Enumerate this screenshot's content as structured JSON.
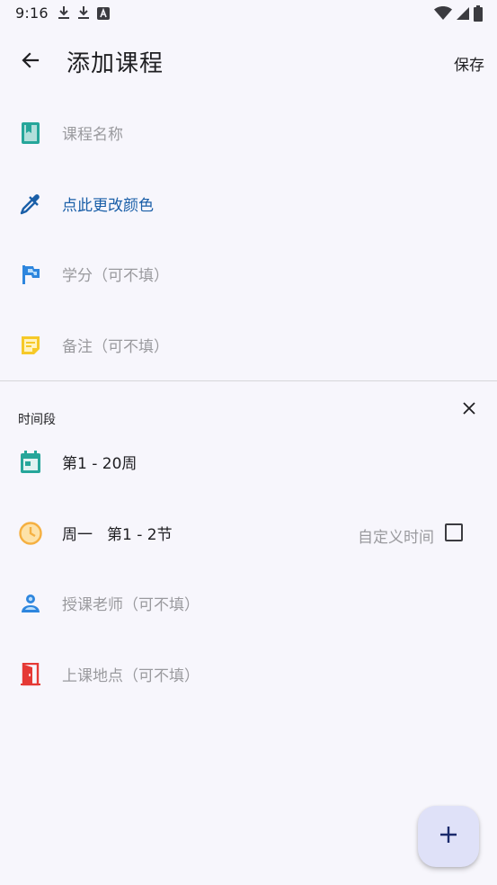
{
  "status_bar": {
    "time": "9:16",
    "left_icons": [
      "download-icon",
      "download-icon",
      "text-a-icon"
    ],
    "right_icons": [
      "wifi-icon",
      "cell-signal-icon",
      "battery-icon"
    ]
  },
  "app_bar": {
    "title": "添加课程",
    "save_label": "保存",
    "back_icon": "arrow-back-icon"
  },
  "course_fields": [
    {
      "key": "name",
      "placeholder": "课程名称",
      "icon": "book-icon",
      "icon_color": "#26a69a"
    },
    {
      "key": "color",
      "text": "点此更改颜色",
      "icon": "eyedropper-icon",
      "icon_color": "#1a5fa8"
    },
    {
      "key": "credit",
      "placeholder": "学分（可不填）",
      "icon": "flag-icon",
      "icon_color": "#2e86de"
    },
    {
      "key": "note",
      "placeholder": "备注（可不填）",
      "icon": "note-icon",
      "icon_color": "#f6c928"
    }
  ],
  "time_section": {
    "label": "时间段",
    "close_icon": "close-icon",
    "weeks": {
      "text": "第1 - 20周",
      "icon": "calendar-icon",
      "icon_color": "#26a69a"
    },
    "time": {
      "day": "周一",
      "period": "第1 - 2节",
      "icon": "clock-icon",
      "icon_color": "#f5b041"
    },
    "custom_time": {
      "label": "自定义时间",
      "checked": false
    },
    "teacher": {
      "placeholder": "授课老师（可不填）",
      "icon": "person-icon",
      "icon_color": "#2e86de"
    },
    "location": {
      "placeholder": "上课地点（可不填）",
      "icon": "door-icon",
      "icon_color": "#e53935"
    }
  },
  "fab": {
    "icon": "plus-icon"
  }
}
